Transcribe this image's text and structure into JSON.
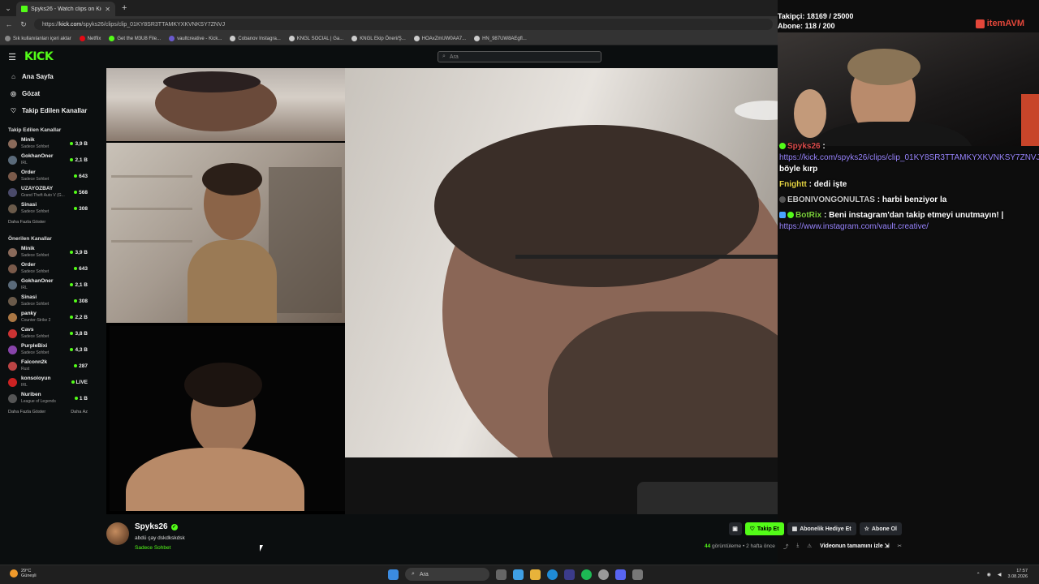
{
  "browser": {
    "tab_title": "Spyks26 - Watch clips on Kick",
    "url_prefix": "https://",
    "url_host": "kick.com",
    "url_path": "/spyks26/clips/clip_01KY8SR3TTAMKYXKVNKSY7ZNVJ",
    "bookmarks": [
      {
        "label": "Sık kullanılanları içeri aktar",
        "color": "#888888"
      },
      {
        "label": "Netflix",
        "color": "#e50914"
      },
      {
        "label": "Get the M3U8 File...",
        "color": "#53fc18"
      },
      {
        "label": "vaultcreative - Kick...",
        "color": "#6a5acd"
      },
      {
        "label": "Cobanov Instagra...",
        "color": "#cccccc"
      },
      {
        "label": "KNGL SOCIAL | Ga...",
        "color": "#cccccc"
      },
      {
        "label": "KNGL Ekip Öneri/Ş...",
        "color": "#cccccc"
      },
      {
        "label": "HOAxZmUW0AA7...",
        "color": "#cccccc"
      },
      {
        "label": "HN_987UW8AEgfl...",
        "color": "#cccccc"
      }
    ]
  },
  "header": {
    "logo": "KICK",
    "search_placeholder": "Ara"
  },
  "sidebar": {
    "nav": [
      {
        "label": "Ana Sayfa",
        "icon": "home-icon"
      },
      {
        "label": "Gözat",
        "icon": "browse-icon"
      },
      {
        "label": "Takip Edilen Kanallar",
        "icon": "heart-icon"
      }
    ],
    "followed_title": "Takip Edilen Kanallar",
    "followed": [
      {
        "name": "Minik",
        "cat": "Sadece Sohbet",
        "viewers": "3,9 B",
        "color": "#8a6a5a"
      },
      {
        "name": "GokhanOner",
        "cat": "IRL",
        "viewers": "2,1 B",
        "color": "#5a6a7a"
      },
      {
        "name": "Order",
        "cat": "Sadece Sohbet",
        "viewers": "643",
        "color": "#7a5a4a"
      },
      {
        "name": "UZAYOZBAY",
        "cat": "Grand Theft Auto V (G...",
        "viewers": "568",
        "color": "#4a4a6a"
      },
      {
        "name": "Sinasi",
        "cat": "Sadece Sohbet",
        "viewers": "308",
        "color": "#6a5a4a"
      }
    ],
    "followed_more": "Daha Fazla Göster",
    "recommended_title": "Önerilen Kanallar",
    "recommended": [
      {
        "name": "Minik",
        "cat": "Sadece Sohbet",
        "viewers": "3,9 B",
        "color": "#8a6a5a"
      },
      {
        "name": "Order",
        "cat": "Sadece Sohbet",
        "viewers": "643",
        "color": "#7a5a4a"
      },
      {
        "name": "GokhanOner",
        "cat": "IRL",
        "viewers": "2,1 B",
        "color": "#5a6a7a"
      },
      {
        "name": "Sinasi",
        "cat": "Sadece Sohbet",
        "viewers": "308",
        "color": "#6a5a4a"
      },
      {
        "name": "panky",
        "cat": "Counter-Strike 2",
        "viewers": "2,2 B",
        "color": "#aa7744"
      },
      {
        "name": "Cavs",
        "cat": "Sadece Sohbet",
        "viewers": "3,8 B",
        "color": "#cc3333"
      },
      {
        "name": "PurpleBixi",
        "cat": "Sadece Sohbet",
        "viewers": "4,3 B",
        "color": "#8844aa"
      },
      {
        "name": "Falconn2k",
        "cat": "Rust",
        "viewers": "287",
        "color": "#bb4444"
      },
      {
        "name": "konsoloyun",
        "cat": "IRL",
        "viewers": "LIVE",
        "color": "#cc2222"
      },
      {
        "name": "Nuriben",
        "cat": "League of Legends",
        "viewers": "1 B",
        "color": "#555555"
      }
    ],
    "rec_more": "Daha Fazla Göster",
    "rec_less": "Daha Az"
  },
  "overlay": {
    "followers": "Takipçi: 18169 / 25000",
    "subs": "Abone: 118 / 200",
    "brand": "itemAVM",
    "chat": [
      {
        "user": "Spyks26",
        "sep": " :",
        "text": "",
        "link": "https://kick.com/spyks26/clips/clip_01KY8SR3TTAMKYXKVNKSY7ZNVJ",
        "after": " böyle kırp",
        "ucls": "u-red",
        "badge": "green"
      },
      {
        "user": "Fnightt",
        "sep": " :",
        "text": " dedi işte",
        "link": "",
        "after": "",
        "ucls": "u-yellow",
        "badge": ""
      },
      {
        "user": "EBONIVONGONULTAS",
        "sep": " :",
        "text": " harbi benziyor la",
        "link": "",
        "after": "",
        "ucls": "u-purple",
        "badge": "dark"
      },
      {
        "user": "BotRix",
        "sep": " :",
        "text": " Beni instagram'dan takip etmeyi unutmayın! |",
        "link": "https://www.instagram.com/vault.creative/",
        "after": "",
        "ucls": "u-green",
        "badge": "blue"
      }
    ]
  },
  "streamer": {
    "name": "Spyks26",
    "title": "abdü çay dskdkskdsk",
    "category": "Sadece Sohbet",
    "follow": "Takip Et",
    "gift": "Abonelik Hediye Et",
    "subscribe": "Abone Ol",
    "views": "44",
    "views_label": " görüntüleme",
    "time": "• 2 hafta önce",
    "full_video": "Videonun tamamını izle"
  },
  "taskbar": {
    "temp": "29°C",
    "weather": "Güneşli",
    "search": "Ara",
    "time": "17:57",
    "date": "3.08.2026"
  }
}
